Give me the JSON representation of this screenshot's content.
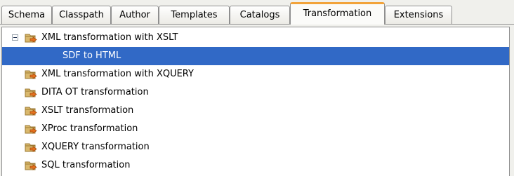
{
  "tabs": [
    {
      "label": "Schema"
    },
    {
      "label": "Classpath"
    },
    {
      "label": "Author"
    },
    {
      "label": "Templates"
    },
    {
      "label": "Catalogs"
    },
    {
      "label": "Transformation",
      "active": true
    },
    {
      "label": "Extensions"
    }
  ],
  "tree": {
    "items": [
      {
        "label": "XML transformation with XSLT",
        "expanded": true,
        "icon": "transformation-icon"
      },
      {
        "label": "SDF to HTML",
        "selected": true
      },
      {
        "label": "XML transformation with XQUERY",
        "icon": "transformation-icon"
      },
      {
        "label": "DITA OT transformation",
        "icon": "transformation-icon"
      },
      {
        "label": "XSLT transformation",
        "icon": "transformation-icon"
      },
      {
        "label": "XProc transformation",
        "icon": "transformation-icon"
      },
      {
        "label": "XQUERY transformation",
        "icon": "transformation-icon"
      },
      {
        "label": "SQL transformation",
        "icon": "transformation-icon"
      }
    ]
  },
  "colors": {
    "selection": "#3169c6",
    "active_tab_accent": "#f2a33a",
    "icon_folder": "#c6a25a",
    "icon_arrow": "#e8731e"
  }
}
